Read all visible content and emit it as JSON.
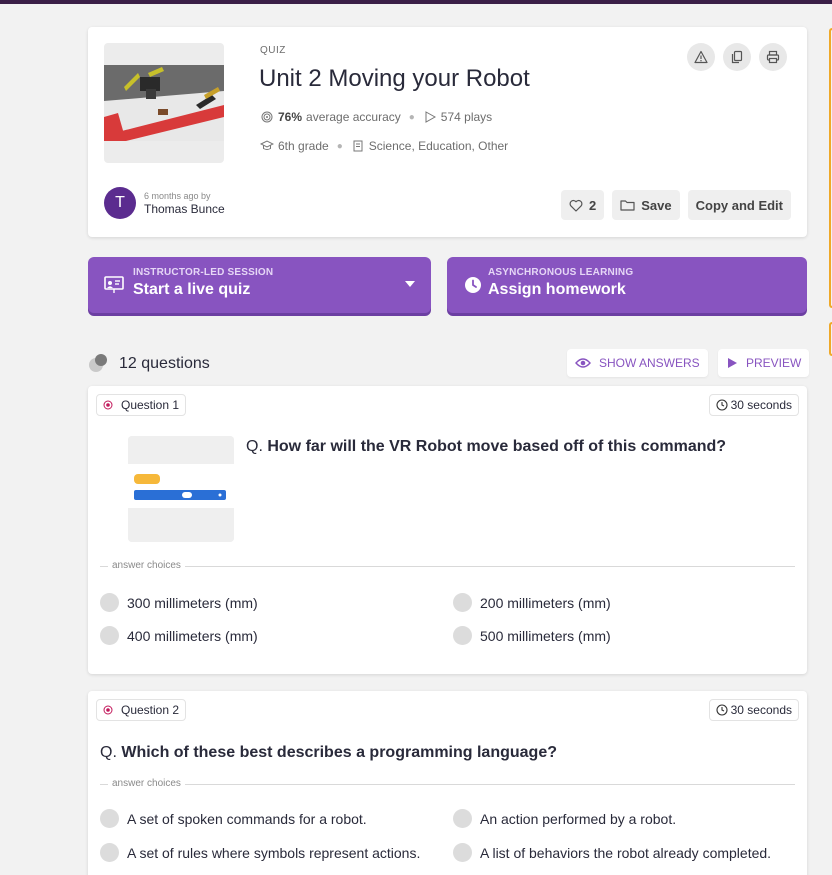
{
  "header": {
    "type_label": "QUIZ",
    "title": "Unit 2 Moving your Robot",
    "accuracy_value": "76%",
    "accuracy_label": "average accuracy",
    "plays": "574 plays",
    "grade": "6th grade",
    "subjects": "Science, Education, Other",
    "author_initial": "T",
    "author_time": "6 months ago by",
    "author_name": "Thomas Bunce",
    "likes": "2",
    "save_label": "Save",
    "copy_edit_label": "Copy and Edit"
  },
  "cta": {
    "live_kicker": "INSTRUCTOR-LED SESSION",
    "live_label": "Start a live quiz",
    "hw_kicker": "ASYNCHRONOUS LEARNING",
    "hw_label": "Assign homework"
  },
  "questions_header": {
    "count_label": "12 questions",
    "show_answers": "SHOW ANSWERS",
    "preview": "PREVIEW"
  },
  "questions": [
    {
      "label": "Question 1",
      "time": "30 seconds",
      "prefix": "Q.",
      "text": "How far will the VR Robot move based off of this command?",
      "divider": "answer choices",
      "choices": [
        "300 millimeters (mm)",
        "200 millimeters (mm)",
        "400 millimeters (mm)",
        "500 millimeters (mm)"
      ]
    },
    {
      "label": "Question 2",
      "time": "30 seconds",
      "prefix": "Q.",
      "text": "Which of these best describes a programming language?",
      "divider": "answer choices",
      "choices": [
        "A set of spoken commands for a robot.",
        "An action performed by a robot.",
        "A set of rules where symbols represent actions.",
        "A list of behaviors the robot already completed."
      ]
    }
  ],
  "colors": {
    "brand_purple": "#8854c0",
    "topbar": "#3b1f47",
    "accent_orange": "#efa929"
  }
}
